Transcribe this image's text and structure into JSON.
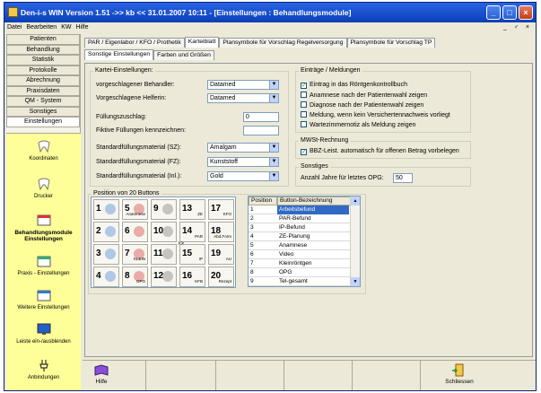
{
  "window": {
    "title": "Den-i-s WIN Version 1.51 ->> kb << 31.01.2007 10:11 - [Einstellungen : Behandlungsmodule]",
    "controls": [
      "_",
      "□",
      "×"
    ]
  },
  "menu": {
    "items": [
      "Datei",
      "Bearbeiten",
      "KW",
      "Hilfe"
    ],
    "mdi_controls": "_ ♂ ×"
  },
  "sidebar": {
    "items": [
      "Patienten",
      "Behandlung",
      "Statistik",
      "Protokolle",
      "Abrechnung",
      "Praxisdaten",
      "QM - System",
      "Sonstiges",
      "Einstellungen"
    ],
    "icons": [
      {
        "label": "Koordinaten"
      },
      {
        "label": "Drucker"
      },
      {
        "label": "Behandlungsmodule Einstellungen"
      },
      {
        "label": "Praxis - Einstellungen"
      },
      {
        "label": "Weitere Einstellungen"
      },
      {
        "label": "Leiste ein-/ausblenden"
      },
      {
        "label": "Anbindungen"
      }
    ]
  },
  "tabs_row1": [
    "PAR / Eigenlabor / KFO / Prothetik",
    "Karteiblatt",
    "Plansymbole für Vorschlag Regelversorgung",
    "Plansymbole für Vorschlag TP"
  ],
  "tabs_row2": [
    "Sonstige Einstellungen",
    "Farben und Größen"
  ],
  "kartei": {
    "group_label": "Kartei-Einstellungen:",
    "behandler_label": "vorgeschlagener Behandler:",
    "behandler_value": "Datamed",
    "helferin_label": "Vorgeschlagene Helferin:",
    "helferin_value": "Datamed",
    "fuellung_label": "Füllungszuschlag:",
    "fuellung_value": "0",
    "fiktive_label": "Fiktive Füllungen kennzeichnen:",
    "fiktive_value": "",
    "sz_label": "Standardfüllungsmaterial (SZ):",
    "sz_value": "Amalgam",
    "fz_label": "Standardfüllungsmaterial (FZ):",
    "fz_value": "Kunststoff",
    "inl_label": "Standardfüllungsmaterial (Inl.):",
    "inl_value": "Gold"
  },
  "eintraege": {
    "group_label": "Einträge / Meldungen",
    "items": [
      {
        "label": "Eintrag in das Röntgenkontrollbuch",
        "checked": true
      },
      {
        "label": "Anamnese nach der Patientenwahl zeigen",
        "checked": false
      },
      {
        "label": "Diagnose nach der Patientenwahl zeigen",
        "checked": false
      },
      {
        "label": "Meldung, wenn kein Versichertennachweis vorliegt",
        "checked": false
      },
      {
        "label": "Wartezimmernotiz als Meldung zeigen",
        "checked": false
      }
    ]
  },
  "mwst": {
    "group_label": "MWSt-Rechnung",
    "item": {
      "label": "BBZ-Leist. automatisch für offenen Betrag vorbelegen",
      "checked": true
    }
  },
  "sonstiges": {
    "group_label": "Sonstiges",
    "opg_label": "Anzahl Jahre für letztes OPG:",
    "opg_value": "50"
  },
  "buttons_group": {
    "label": "Position von 20 Buttons",
    "buttons": [
      {
        "num": "1",
        "sub": ""
      },
      {
        "num": "5",
        "sub": "Anamnese"
      },
      {
        "num": "9",
        "sub": ""
      },
      {
        "num": "13",
        "sub": "ZE"
      },
      {
        "num": "17",
        "sub": "KFO"
      },
      {
        "num": "2",
        "sub": ""
      },
      {
        "num": "6",
        "sub": ""
      },
      {
        "num": "10",
        "sub": ""
      },
      {
        "num": "14",
        "sub": "PAR"
      },
      {
        "num": "18",
        "sub": "Abd.Form"
      },
      {
        "num": "3",
        "sub": ""
      },
      {
        "num": "7",
        "sub": "KLEIN"
      },
      {
        "num": "11",
        "sub": ""
      },
      {
        "num": "15",
        "sub": "IP"
      },
      {
        "num": "19",
        "sub": "AU"
      },
      {
        "num": "4",
        "sub": ""
      },
      {
        "num": "8",
        "sub": "OPG"
      },
      {
        "num": "12",
        "sub": ""
      },
      {
        "num": "16",
        "sub": "KFB"
      },
      {
        "num": "20",
        "sub": "Rezept"
      }
    ],
    "arrow": ">>"
  },
  "table": {
    "col_position": "Position",
    "col_name": "Button-Bezeichnung",
    "rows": [
      {
        "pos": "1",
        "name": "Arbeitsbefund"
      },
      {
        "pos": "2",
        "name": "PAR-Befund"
      },
      {
        "pos": "3",
        "name": "IP-Befund"
      },
      {
        "pos": "4",
        "name": "ZE-Planung"
      },
      {
        "pos": "5",
        "name": "Anamnese"
      },
      {
        "pos": "6",
        "name": "Video"
      },
      {
        "pos": "7",
        "name": "Kleinröntgen"
      },
      {
        "pos": "8",
        "name": "OPG"
      },
      {
        "pos": "9",
        "name": "Tel-gesamt"
      }
    ],
    "selected_row": 0
  },
  "footer": {
    "help_label": "Hilfe",
    "close_label": "Schliessen"
  },
  "colors": {
    "titlebar": "#0a3fb5",
    "sidebar_icons_bg": "#ffff99",
    "selection": "#316ac5"
  }
}
